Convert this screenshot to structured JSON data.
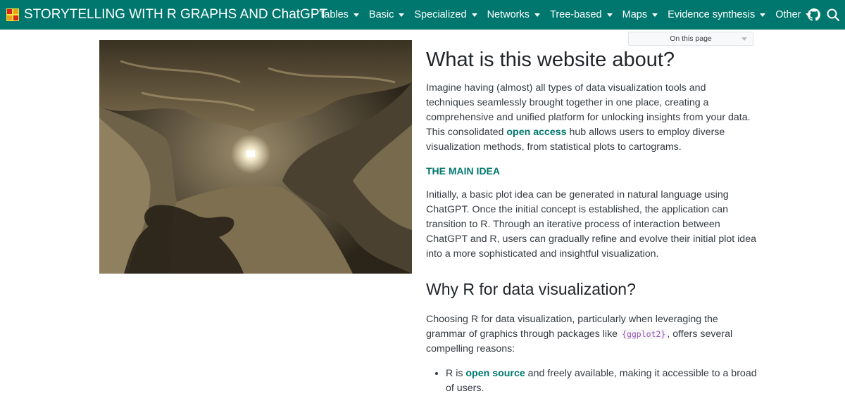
{
  "navbar": {
    "brand": "STORYTELLING WITH R GRAPHS AND ChatGPT",
    "menu": [
      {
        "label": "Tables"
      },
      {
        "label": "Basic"
      },
      {
        "label": "Specialized"
      },
      {
        "label": "Networks"
      },
      {
        "label": "Tree-based"
      },
      {
        "label": "Maps"
      },
      {
        "label": "Evidence synthesis"
      },
      {
        "label": "Other"
      }
    ],
    "icons": [
      "github-icon",
      "search-icon"
    ],
    "background_color": "#00776e"
  },
  "toc": {
    "label": "On this page"
  },
  "content": {
    "h1": "What is this website about?",
    "p1_before": "Imagine having (almost) all types of data visualization tools and techniques seamlessly brought together in one place, creating a comprehensive and unified platform for unlocking insights from your data. This consolidated ",
    "p1_link": "open access",
    "p1_after": " hub allows users to employ diverse visualization methods, from statistical plots to cartograms.",
    "subhead": "THE MAIN IDEA",
    "p2": "Initially, a basic plot idea can be generated in natural language using ChatGPT. Once the initial concept is established, the application can transition to R. Through an iterative process of interaction between ChatGPT and R, users can gradually refine and evolve their initial plot idea into a more sophisticated and insightful visualization.",
    "h2": "Why R for data visualization?",
    "p3_before": "Choosing R for data visualization, particularly when leveraging the grammar of graphics through packages like ",
    "p3_code": "{ggplot2}",
    "p3_after": ", offers several compelling reasons:",
    "bullet1_before": "R is ",
    "bullet1_link": "open source",
    "bullet1_after": " and freely available, making it accessible to a broad of users."
  },
  "colors": {
    "accent": "#00776e",
    "code": "#9753b8"
  }
}
